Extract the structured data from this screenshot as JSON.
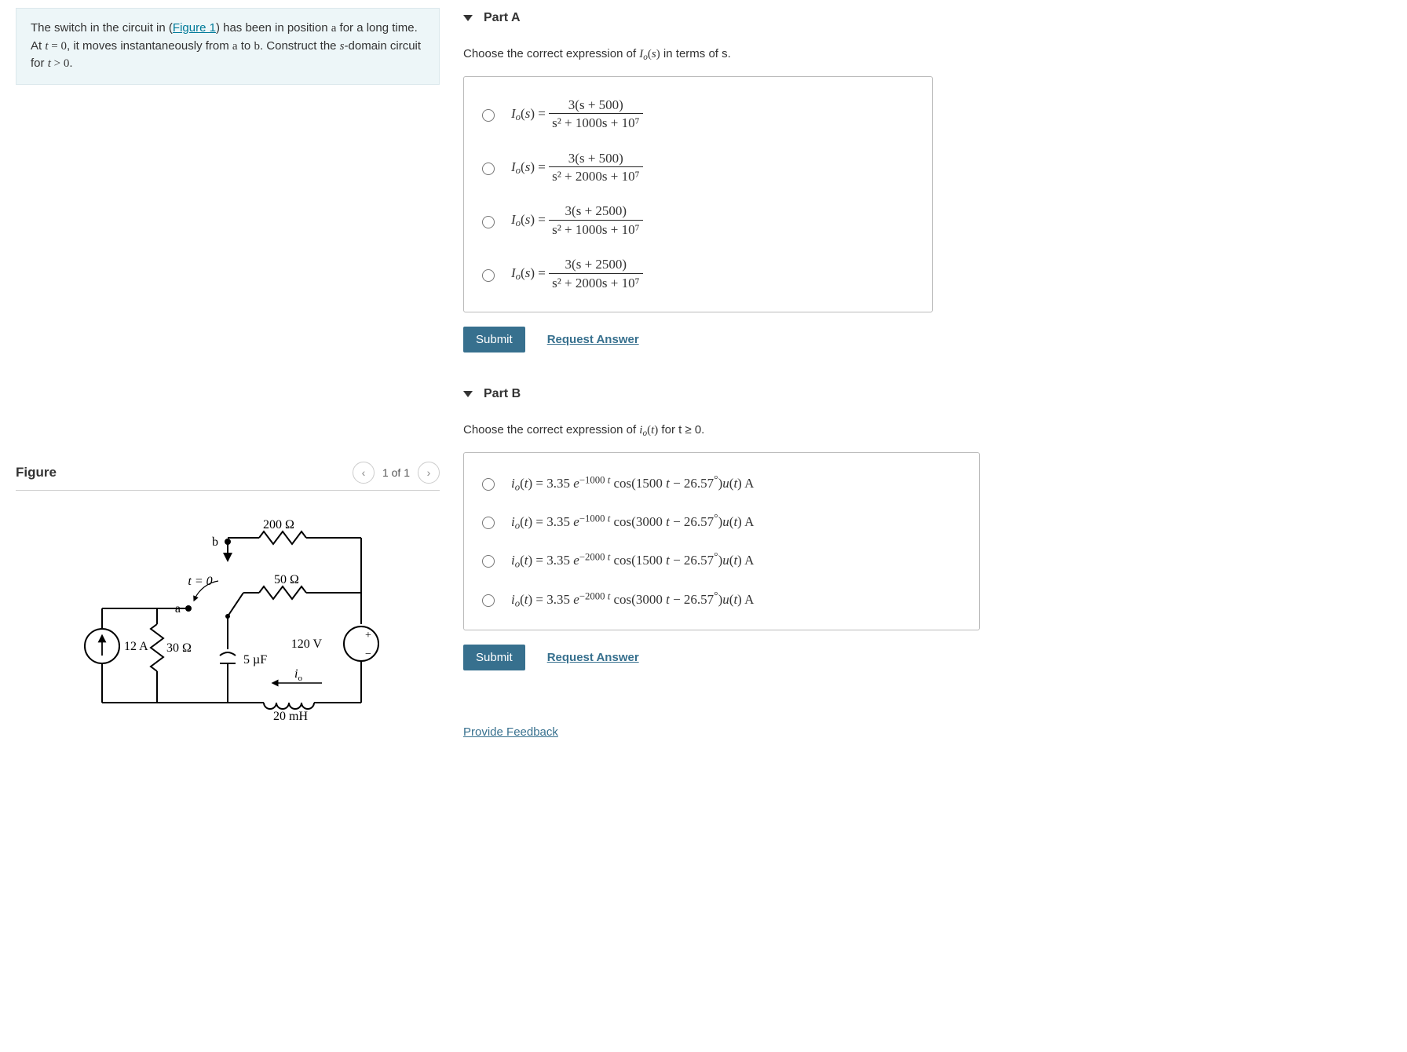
{
  "problem": {
    "text_pre": "The switch in the circuit in (",
    "figure_link": "Figure 1",
    "text_post": ") has been in position a for a long time. At t = 0, it moves instantaneously from a to b. Construct the s-domain circuit for t > 0."
  },
  "figure": {
    "title": "Figure",
    "pager": "1 of 1",
    "labels": {
      "b": "b",
      "a": "a",
      "t0": "t = 0",
      "r200": "200 Ω",
      "r50": "50 Ω",
      "r30": "30 Ω",
      "src": "12 A",
      "cap": "5 µF",
      "vsrc": "120 V",
      "io": "i",
      "io_sub": "o",
      "ind": "20 mH"
    }
  },
  "partA": {
    "title": "Part A",
    "prompt_pre": "Choose the correct expression of ",
    "prompt_post": " in terms of s.",
    "options": [
      {
        "num": "3(s + 500)",
        "den": "s² + 1000s + 10⁷"
      },
      {
        "num": "3(s + 500)",
        "den": "s² + 2000s + 10⁷"
      },
      {
        "num": "3(s + 2500)",
        "den": "s² + 1000s + 10⁷"
      },
      {
        "num": "3(s + 2500)",
        "den": "s² + 2000s + 10⁷"
      }
    ],
    "submit": "Submit",
    "request": "Request Answer"
  },
  "partB": {
    "title": "Part B",
    "prompt_pre": "Choose the correct expression of ",
    "prompt_post": " for t ≥ 0.",
    "options": [
      {
        "text": "iₒ(t) = 3.35 e⁻¹⁰⁰⁰ ᵗ cos(1500 t − 26.57°)u(t) A"
      },
      {
        "text": "iₒ(t) = 3.35 e⁻¹⁰⁰⁰ ᵗ cos(3000 t − 26.57°)u(t) A"
      },
      {
        "text": "iₒ(t) = 3.35 e⁻²⁰⁰⁰ ᵗ cos(1500 t − 26.57°)u(t) A"
      },
      {
        "text": "iₒ(t) = 3.35 e⁻²⁰⁰⁰ ᵗ cos(3000 t − 26.57°)u(t) A"
      }
    ],
    "submit": "Submit",
    "request": "Request Answer"
  },
  "feedback": "Provide Feedback"
}
